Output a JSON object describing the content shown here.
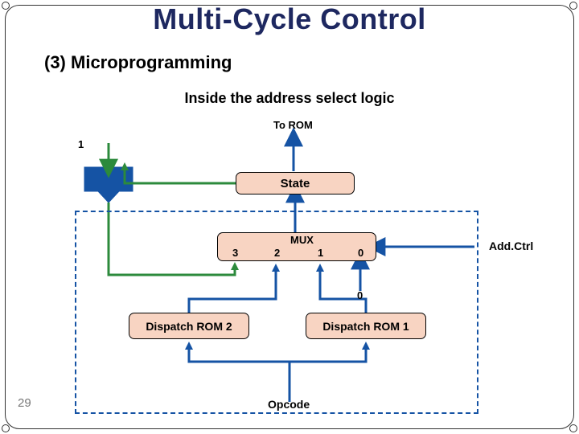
{
  "title": "Multi-Cycle Control",
  "subtitle": "(3) Microprogramming",
  "caption": "Inside the address select logic",
  "labels": {
    "to_rom": "To ROM",
    "one_left": "1",
    "addctrl": "Add.Ctrl",
    "zero_right": "0",
    "opcode": "Opcode"
  },
  "blocks": {
    "state": "State",
    "mux": {
      "title": "MUX",
      "ports": [
        "3",
        "2",
        "1",
        "0"
      ]
    },
    "dispatch2": "Dispatch ROM 2",
    "dispatch1": "Dispatch ROM 1"
  },
  "colors": {
    "arrow_blue": "#1553a4",
    "arrow_green": "#2c8a3c",
    "box_fill": "#f8d4c2"
  },
  "slide_number": "29"
}
